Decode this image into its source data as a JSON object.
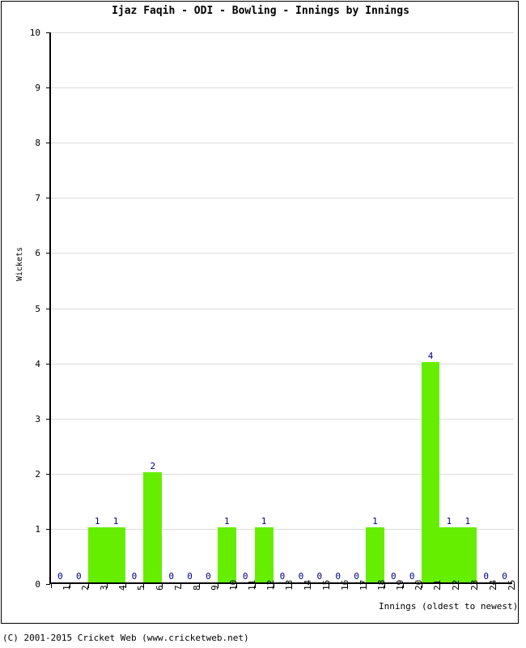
{
  "chart_data": {
    "type": "bar",
    "title": "Ijaz Faqih - ODI - Bowling - Innings by Innings",
    "xlabel": "Innings (oldest to newest)",
    "ylabel": "Wickets",
    "ylim": [
      0,
      10
    ],
    "ytick_labels": [
      "0",
      "1",
      "2",
      "3",
      "4",
      "5",
      "6",
      "7",
      "8",
      "9",
      "10"
    ],
    "grid": true,
    "legend": "none",
    "bar_color": "#66ee00",
    "value_label_color": "#000080",
    "gridline_color": "#dcdcdc",
    "axis_color": "#000000",
    "categories": [
      "1",
      "2",
      "3",
      "4",
      "5",
      "6",
      "7",
      "8",
      "9",
      "10",
      "11",
      "12",
      "13",
      "14",
      "15",
      "16",
      "17",
      "18",
      "19",
      "20",
      "21",
      "22",
      "23",
      "24",
      "25"
    ],
    "values": [
      0,
      0,
      1,
      1,
      0,
      2,
      0,
      0,
      0,
      1,
      0,
      1,
      0,
      0,
      0,
      0,
      0,
      1,
      0,
      0,
      4,
      1,
      1,
      0,
      0
    ],
    "value_labels": [
      "0",
      "0",
      "1",
      "1",
      "0",
      "2",
      "0",
      "0",
      "0",
      "1",
      "0",
      "1",
      "0",
      "0",
      "0",
      "0",
      "0",
      "1",
      "0",
      "0",
      "4",
      "1",
      "1",
      "0",
      "0"
    ]
  },
  "footer": {
    "copyright": "(C) 2001-2015 Cricket Web (www.cricketweb.net)"
  }
}
